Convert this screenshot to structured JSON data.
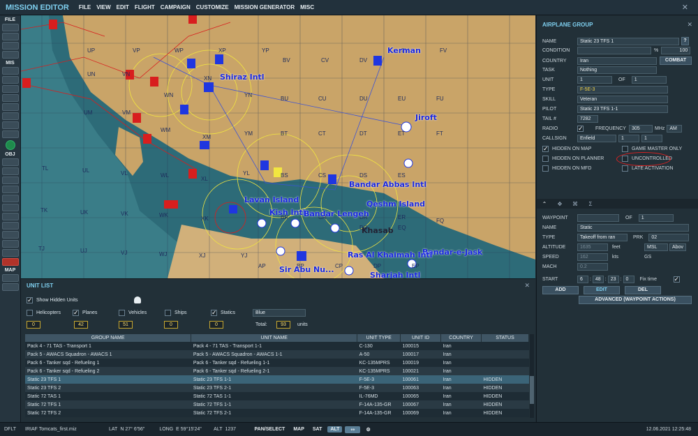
{
  "app": {
    "title": "MISSION EDITOR"
  },
  "menu": [
    "FILE",
    "VIEW",
    "EDIT",
    "FLIGHT",
    "CAMPAIGN",
    "CUSTOMIZE",
    "MISSION GENERATOR",
    "MISC"
  ],
  "toolbar": {
    "file_label": "FILE",
    "mis_label": "MIS",
    "obj_label": "OBJ",
    "map_label": "MAP"
  },
  "map": {
    "places": [
      "Kerman",
      "Shiraz Intl",
      "Jiroft",
      "Lavan Island",
      "Kish Intl",
      "Bandar Abbas Intl",
      "Bandar-e-Jask",
      "Ras Al Khaimah Intl",
      "Sir Abu Nu...",
      "Sharjah Intl",
      "Qeshm Island",
      "Khasab",
      "Bandar Lengeh"
    ],
    "grid": [
      "UP",
      "VP",
      "WP",
      "XP",
      "YP",
      "BV",
      "CV",
      "DV",
      "EV",
      "FV",
      "UN",
      "VN",
      "WN",
      "XN",
      "YN",
      "BU",
      "CU",
      "DU",
      "EU",
      "FU",
      "UM",
      "VM",
      "WM",
      "XM",
      "YM",
      "BT",
      "CT",
      "DT",
      "ET",
      "FT",
      "TL",
      "UL",
      "VL",
      "WL",
      "XL",
      "YL",
      "BS",
      "CS",
      "DS",
      "ES",
      "TK",
      "UK",
      "VK",
      "WK",
      "XK",
      "BR",
      "CR",
      "DR",
      "ER",
      "TJ",
      "UJ",
      "VJ",
      "WJ",
      "XJ",
      "YJ",
      "AP",
      "BP",
      "CP",
      "DP",
      "EP",
      "FQ",
      "EQ",
      "DQ"
    ]
  },
  "airplane_group": {
    "header": "AIRPLANE GROUP",
    "name_label": "NAME",
    "name_value": "Static 23 TFS 1",
    "condition_label": "CONDITION",
    "condition_pct": "%",
    "condition_value": "100",
    "country_label": "COUNTRY",
    "country_value": "Iran",
    "combat_button": "COMBAT",
    "task_label": "TASK",
    "task_value": "Nothing",
    "unit_label": "UNIT",
    "unit_value": "1",
    "of_label": "OF",
    "unit_of": "1",
    "type_label": "TYPE",
    "type_value": "F-5E-3",
    "skill_label": "SKILL",
    "skill_value": "Veteran",
    "pilot_label": "PILOT",
    "pilot_value": "Static 23 TFS 1-1",
    "tail_label": "TAIL #",
    "tail_value": "7282",
    "radio_label": "RADIO",
    "frequency_label": "FREQUENCY",
    "frequency_value": "305",
    "mhz": "MHz",
    "am": "AM",
    "callsign_label": "CALLSIGN",
    "callsign_value": "Enfield",
    "callsign_n1": "1",
    "callsign_n2": "1",
    "hidden_on_map": "HIDDEN ON MAP",
    "game_master_only": "GAME MASTER ONLY",
    "hidden_on_planner": "HIDDEN ON PLANNER",
    "uncontrolled": "UNCONTROLLED",
    "hidden_on_mfd": "HIDDEN ON MFD",
    "late_activation": "LATE ACTIVATION"
  },
  "waypoint": {
    "waypoint_label": "WAYPOINT",
    "of_label": "OF",
    "of_value": "1",
    "name_label": "NAME",
    "name_value": "Static",
    "type_label": "TYPE",
    "type_value": "Takeoff from ran",
    "prk_label": "PRK",
    "prk_value": "02",
    "altitude_label": "ALTITUDE",
    "altitude_value": "1635",
    "feet": "feet",
    "msl": "MSL",
    "abov": "Abov",
    "speed_label": "SPEED",
    "speed_value": "162",
    "kts": "kts",
    "gs": "GS",
    "mach_label": "MACH",
    "mach_value": "0.2",
    "start_label": "START",
    "start_d": "6",
    "start_h": "48",
    "start_m": "23",
    "start_s": "0",
    "fix_time": "Fix time",
    "add": "ADD",
    "edit": "EDIT",
    "del": "DEL",
    "advanced": "ADVANCED (WAYPOINT ACTIONS)"
  },
  "unit_list": {
    "header": "UNIT LIST",
    "show_hidden": "Show Hidden Units",
    "filters": [
      {
        "label": "Helicopters",
        "count": "0",
        "checked": false
      },
      {
        "label": "Planes",
        "count": "42",
        "checked": true
      },
      {
        "label": "Vehicles",
        "count": "51",
        "checked": false
      },
      {
        "label": "Ships",
        "count": "0",
        "checked": false
      },
      {
        "label": "Statics",
        "count": "0",
        "checked": true
      }
    ],
    "coalition": "Blue",
    "total_label": "Total:",
    "total_value": "93",
    "units_label": "units",
    "columns": [
      "GROUP NAME",
      "UNIT NAME",
      "UNIT TYPE",
      "UNIT ID",
      "COUNTRY",
      "STATUS"
    ],
    "rows": [
      [
        "Pack 4 - 71 TAS - Transport 1",
        "Pack 4 - 71 TAS - Transport 1-1",
        "C-130",
        "100015",
        "Iran",
        ""
      ],
      [
        "Pack 5 - AWACS Squadron - AWACS 1",
        "Pack 5 - AWACS Squadron - AWACS 1-1",
        "A-50",
        "100017",
        "Iran",
        ""
      ],
      [
        "Pack 6 - Tanker sqd - Refueling 1",
        "Pack 6 - Tanker sqd - Refueling 1-1",
        "KC-135MPRS",
        "100019",
        "Iran",
        ""
      ],
      [
        "Pack 6 - Tanker sqd - Refueling 2",
        "Pack 6 - Tanker sqd - Refueling 2-1",
        "KC-135MPRS",
        "100021",
        "Iran",
        ""
      ],
      [
        "Static 23 TFS 1",
        "Static 23 TFS 1-1",
        "F-5E-3",
        "100061",
        "Iran",
        "HIDDEN"
      ],
      [
        "Static 23 TFS 2",
        "Static 23 TFS 2-1",
        "F-5E-3",
        "100063",
        "Iran",
        "HIDDEN"
      ],
      [
        "Static 72 TAS 1",
        "Static 72 TAS 1-1",
        "IL-76MD",
        "100065",
        "Iran",
        "HIDDEN"
      ],
      [
        "Static 72 TFS 1",
        "Static 72 TFS 1-1",
        "F-14A-135-GR",
        "100067",
        "Iran",
        "HIDDEN"
      ],
      [
        "Static 72 TFS 2",
        "Static 72 TFS 2-1",
        "F-14A-135-GR",
        "100069",
        "Iran",
        "HIDDEN"
      ]
    ]
  },
  "status": {
    "mode": "DFLT",
    "file": "IRIAF Tomcats_first.miz",
    "lat_label": "LAT",
    "lat_value": "N 27° 6'56\"",
    "long_label": "LONG",
    "long_value": "E 59°15'24\"",
    "alt_label": "ALT",
    "alt_value": "1237",
    "pan_select": "PAN/SELECT",
    "map_btn": "MAP",
    "sat_btn": "SAT",
    "alt_btn": "ALT",
    "datetime": "12.06.2021 12:25:48"
  }
}
